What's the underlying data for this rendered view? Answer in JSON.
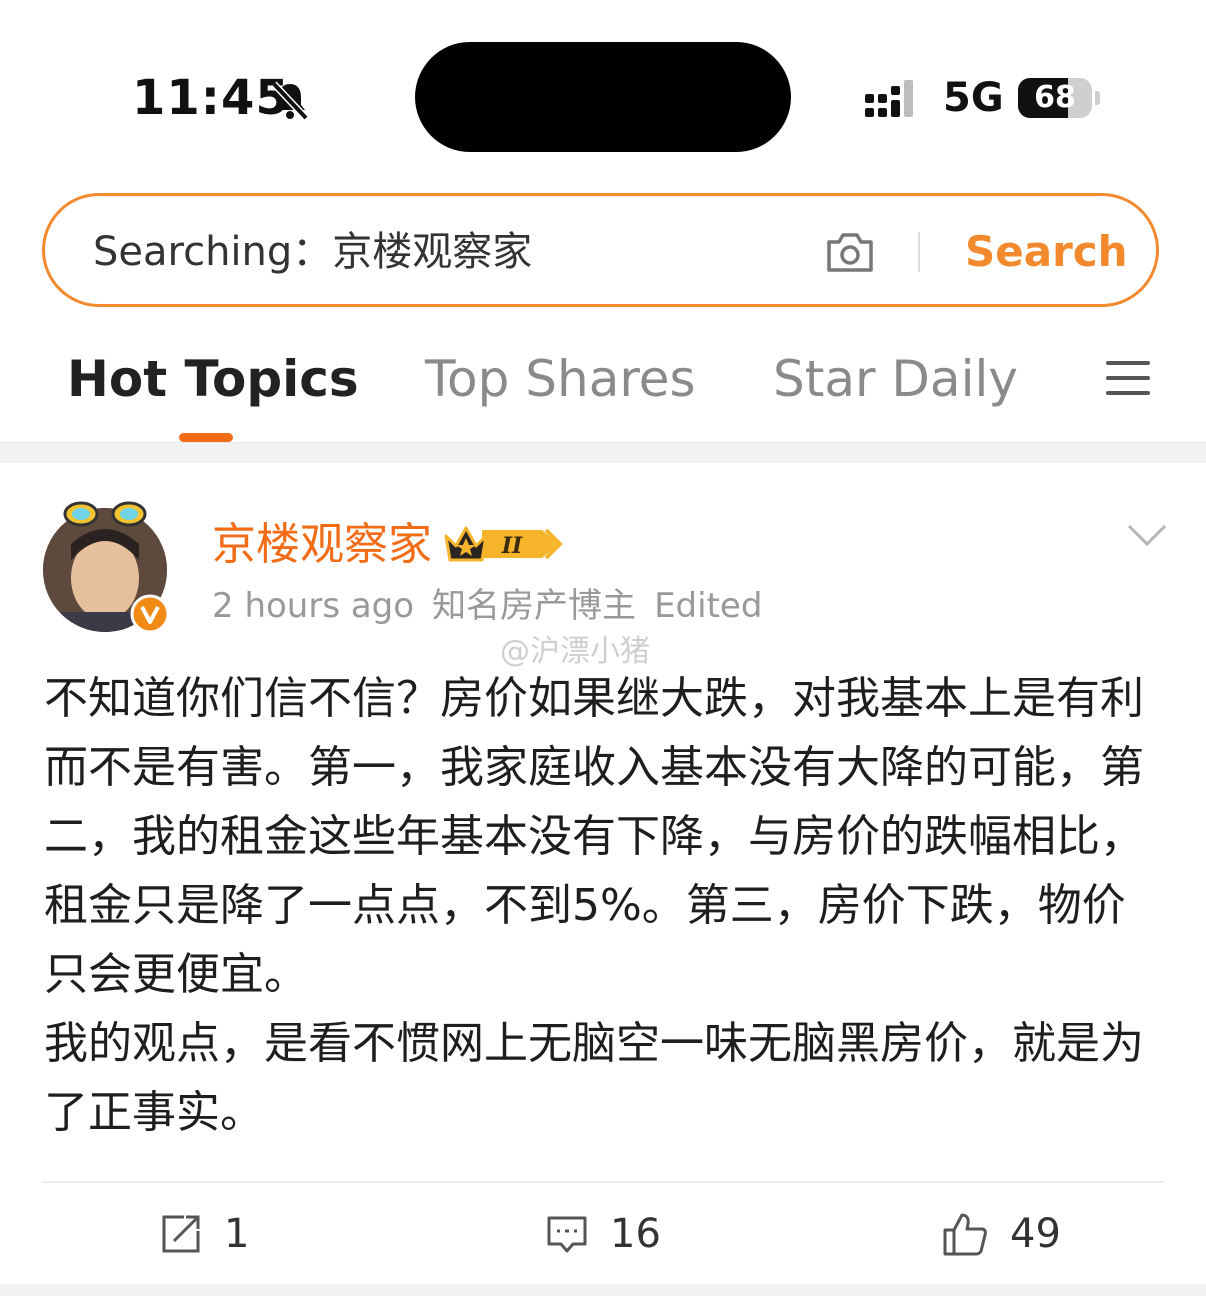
{
  "status_bar": {
    "time": "11:45",
    "network": "5G",
    "battery": 68,
    "battery_label": "68"
  },
  "search": {
    "query_label": "Searching：京楼观察家",
    "button_label": "Search"
  },
  "tabs": [
    {
      "label": "Hot Topics",
      "active": true
    },
    {
      "label": "Top Shares",
      "active": false
    },
    {
      "label": "Star Daily",
      "active": false
    }
  ],
  "post": {
    "author": "京楼观察家",
    "time": "2 hours ago",
    "author_tag": "知名房产博主",
    "edited": "Edited",
    "watermark": "@沪漂小猪",
    "level_badge": "II",
    "paragraphs": [
      "不知道你们信不信？房价如果继大跌，对我基本上是有利而不是有害。第一，我家庭收入基本没有大降的可能，第二，我的租金这些年基本没有下降，与房价的跌幅相比，租金只是降了一点点，不到5%。第三，房价下跌，物价只会更便宜。",
      "我的观点，是看不惯网上无脑空一味无脑黑房价，就是为了正事实。"
    ],
    "actions": {
      "reposts": "1",
      "comments": "16",
      "likes": "49"
    }
  },
  "colors": {
    "accent": "#f26b16",
    "search_border": "#f2892d"
  }
}
